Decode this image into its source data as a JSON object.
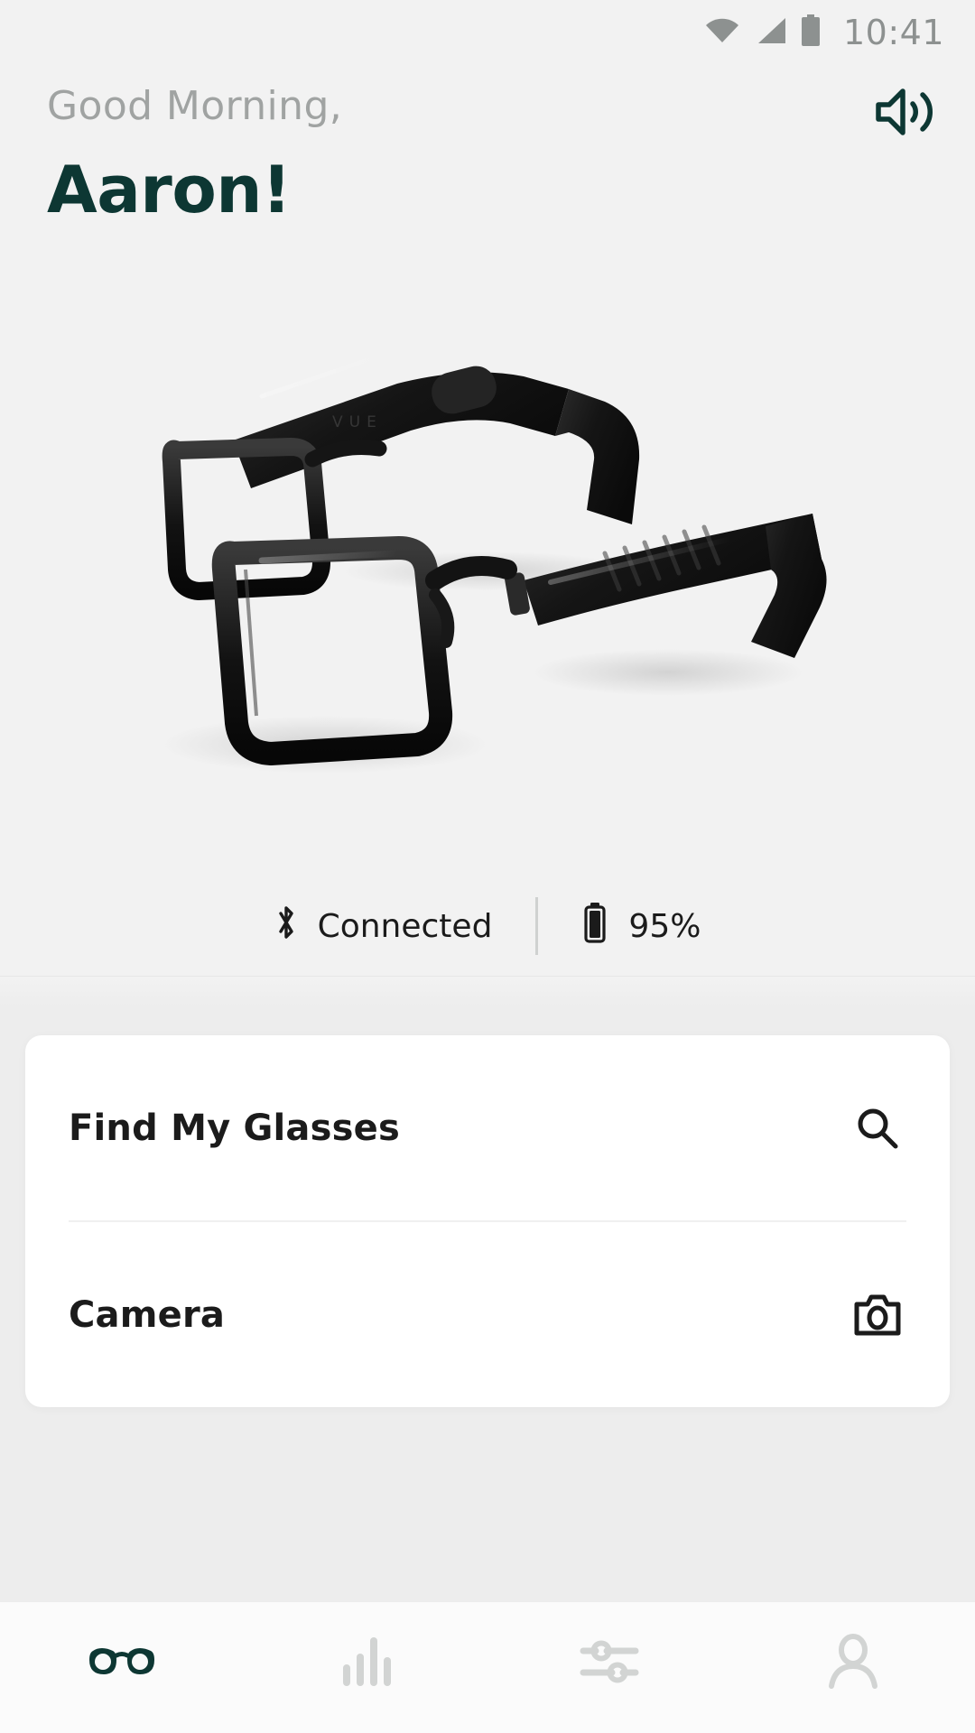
{
  "status_bar": {
    "time": "10:41",
    "icons": [
      "wifi-icon",
      "cellular-signal-icon",
      "battery-icon"
    ],
    "icon_color": "#8d9190"
  },
  "header": {
    "greeting_line1": "Good Morning,",
    "greeting_line2": "Aaron!",
    "greeting_color": "#a0a3a2",
    "name_color": "#0d3733",
    "volume_icon": "volume-speaker-icon",
    "volume_icon_color": "#0d3733"
  },
  "hero": {
    "product_name": "VUE",
    "product_image_alt": "black smart glasses",
    "brand_engraving": "VUE"
  },
  "device_status": {
    "connection_icon": "bluetooth-icon",
    "connection_label": "Connected",
    "battery_icon": "battery-icon",
    "battery_label": "95%",
    "text_color": "#1b1b1b"
  },
  "actions": {
    "rows": [
      {
        "label": "Find My Glasses",
        "icon": "search-icon"
      },
      {
        "label": "Camera",
        "icon": "camera-icon"
      }
    ]
  },
  "bottom_nav": {
    "active_index": 0,
    "active_color": "#0d3733",
    "inactive_color": "#d2d4d3",
    "items": [
      {
        "name": "glasses",
        "icon": "glasses-icon"
      },
      {
        "name": "stats",
        "icon": "bar-chart-icon"
      },
      {
        "name": "settings",
        "icon": "sliders-icon"
      },
      {
        "name": "profile",
        "icon": "person-icon"
      }
    ]
  }
}
